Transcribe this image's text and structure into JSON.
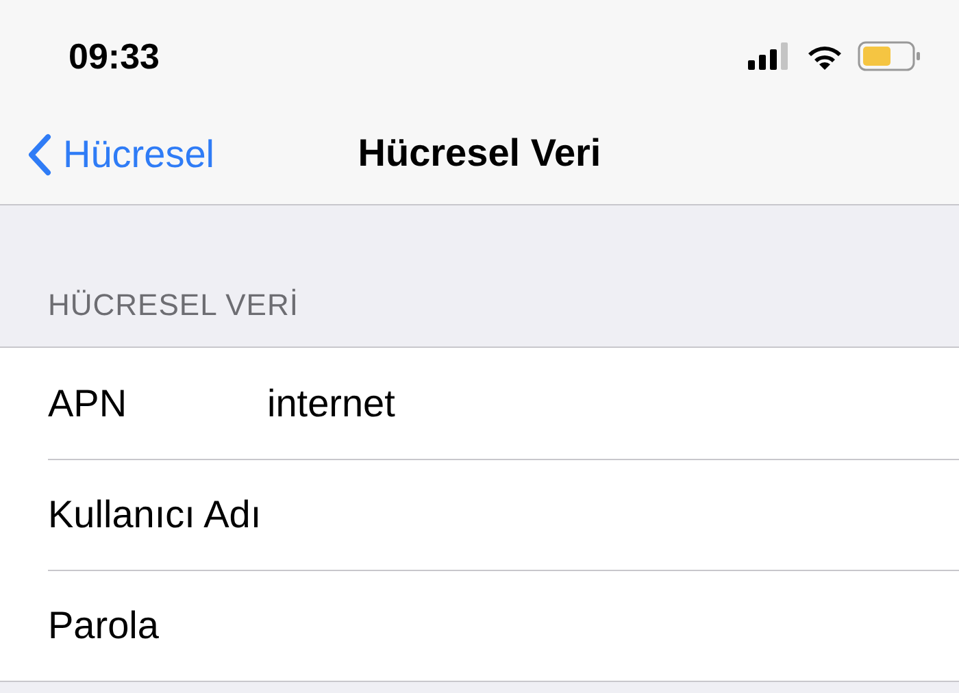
{
  "status_bar": {
    "time": "09:33"
  },
  "nav": {
    "back": "Hücresel",
    "title": "Hücresel Veri"
  },
  "section": {
    "header": "HÜCRESEL VERİ",
    "rows": [
      {
        "label": "APN",
        "value": "internet"
      },
      {
        "label": "Kullanıcı Adı"
      },
      {
        "label": "Parola"
      }
    ]
  }
}
